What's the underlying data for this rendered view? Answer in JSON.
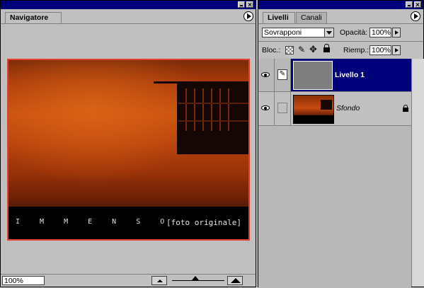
{
  "navigator": {
    "tab_label": "Navigatore",
    "zoom_value": "100%",
    "preview": {
      "caption_word": "I M M E N S O",
      "caption_original": "[foto originale]"
    }
  },
  "layers_panel": {
    "tabs": [
      {
        "label": "Livelli"
      },
      {
        "label": "Canali"
      }
    ],
    "blend_mode": "Sovrapponi",
    "opacity_label": "Opacità:",
    "opacity_value": "100%",
    "lock_label": "Bloc.:",
    "fill_label": "Riemp.:",
    "fill_value": "100%",
    "layers": [
      {
        "name": "Livello 1",
        "selected": true
      },
      {
        "name": "Sfondo",
        "selected": false,
        "locked": true
      }
    ]
  },
  "colors": {
    "title_bar": "#00007b",
    "selection": "#00007b",
    "preview_border": "#e04030"
  }
}
